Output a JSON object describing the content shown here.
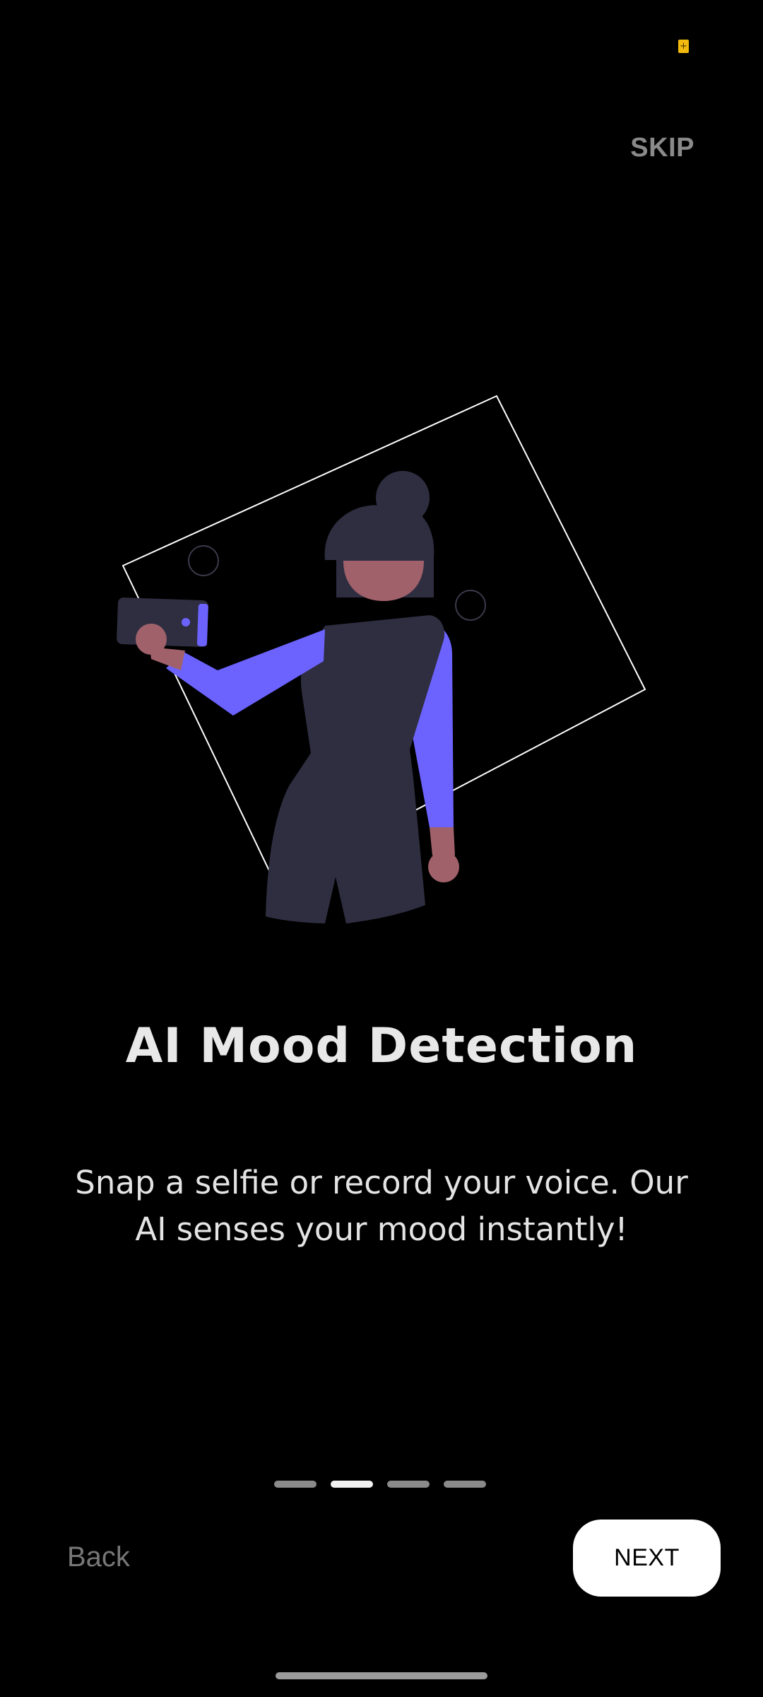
{
  "status_bar": {
    "icon": "battery-saver-icon",
    "glyph": "+",
    "color": "#f2b90f"
  },
  "header": {
    "skip_label": "SKIP"
  },
  "illustration": {
    "name": "woman-taking-selfie-illustration",
    "colors": {
      "accent": "#6c63ff",
      "dark": "#2f2e41",
      "skin": "#a0616a",
      "frame": "#ffffff"
    }
  },
  "content": {
    "title": "AI Mood Detection",
    "description": "Snap a selfie or record your voice. Our AI senses your mood instantly!"
  },
  "pagination": {
    "total": 4,
    "active_index": 1
  },
  "footer": {
    "back_label": "Back",
    "next_label": "NEXT"
  }
}
